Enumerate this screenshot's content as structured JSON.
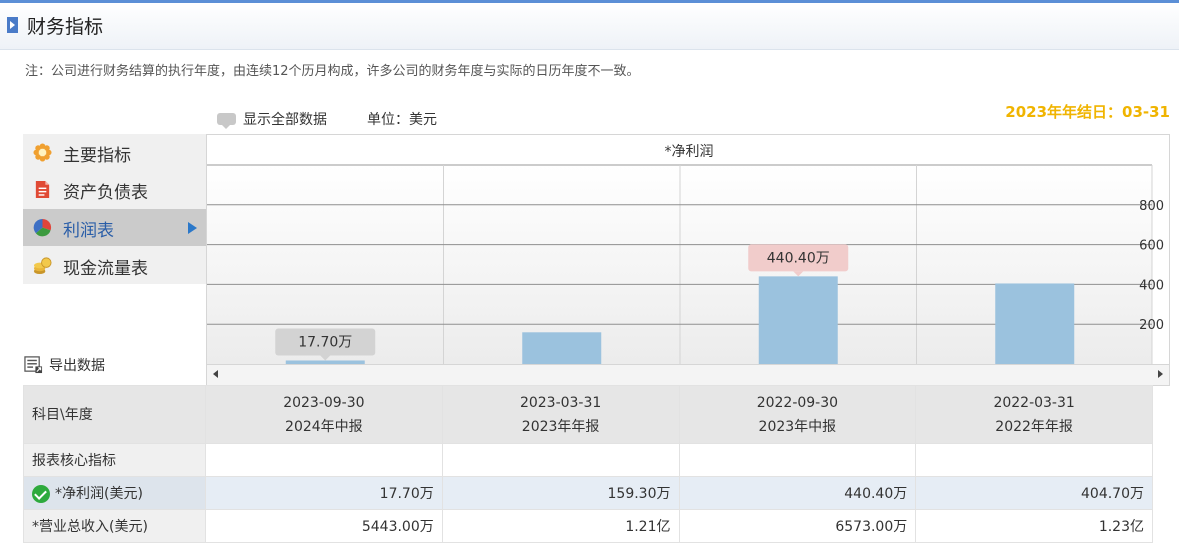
{
  "header": {
    "title": "财务指标"
  },
  "note": "注：公司进行财务结算的执行年度，由连续12个历月构成，许多公司的财务年度与实际的日历年度不一致。",
  "controls": {
    "show_all": "显示全部数据",
    "unit": "单位：美元",
    "fiscal_year_end": "2023年年结日：03-31"
  },
  "menu": {
    "items": [
      {
        "label": "主要指标",
        "icon": "gear-flower-icon"
      },
      {
        "label": "资产负债表",
        "icon": "document-icon"
      },
      {
        "label": "利润表",
        "icon": "pie-chart-icon",
        "active": true
      },
      {
        "label": "现金流量表",
        "icon": "coins-icon"
      }
    ],
    "export_label": "导出数据"
  },
  "chart_data": {
    "type": "bar",
    "title": "*净利润",
    "categories": [
      "2023-09-30",
      "2023-03-31",
      "2022-09-30",
      "2022-03-31"
    ],
    "values": [
      17.7,
      159.3,
      440.4,
      404.7
    ],
    "data_labels": [
      "17.70万",
      "",
      "440.40万",
      ""
    ],
    "yticks": [
      200,
      400,
      600,
      800
    ],
    "ylim": [
      0,
      1000
    ],
    "grid": true,
    "bar_color": "#9bc2de"
  },
  "table": {
    "corner": "科目\\年度",
    "columns": [
      {
        "date": "2023-09-30",
        "period": "2024年中报"
      },
      {
        "date": "2023-03-31",
        "period": "2023年年报"
      },
      {
        "date": "2022-09-30",
        "period": "2023年中报"
      },
      {
        "date": "2022-03-31",
        "period": "2022年年报"
      }
    ],
    "section_label": "报表核心指标",
    "rows": [
      {
        "label": "*净利润(美元)",
        "values": [
          "17.70万",
          "159.30万",
          "440.40万",
          "404.70万"
        ]
      },
      {
        "label": "*营业总收入(美元)",
        "values": [
          "5443.00万",
          "1.21亿",
          "6573.00万",
          "1.23亿"
        ]
      }
    ]
  }
}
